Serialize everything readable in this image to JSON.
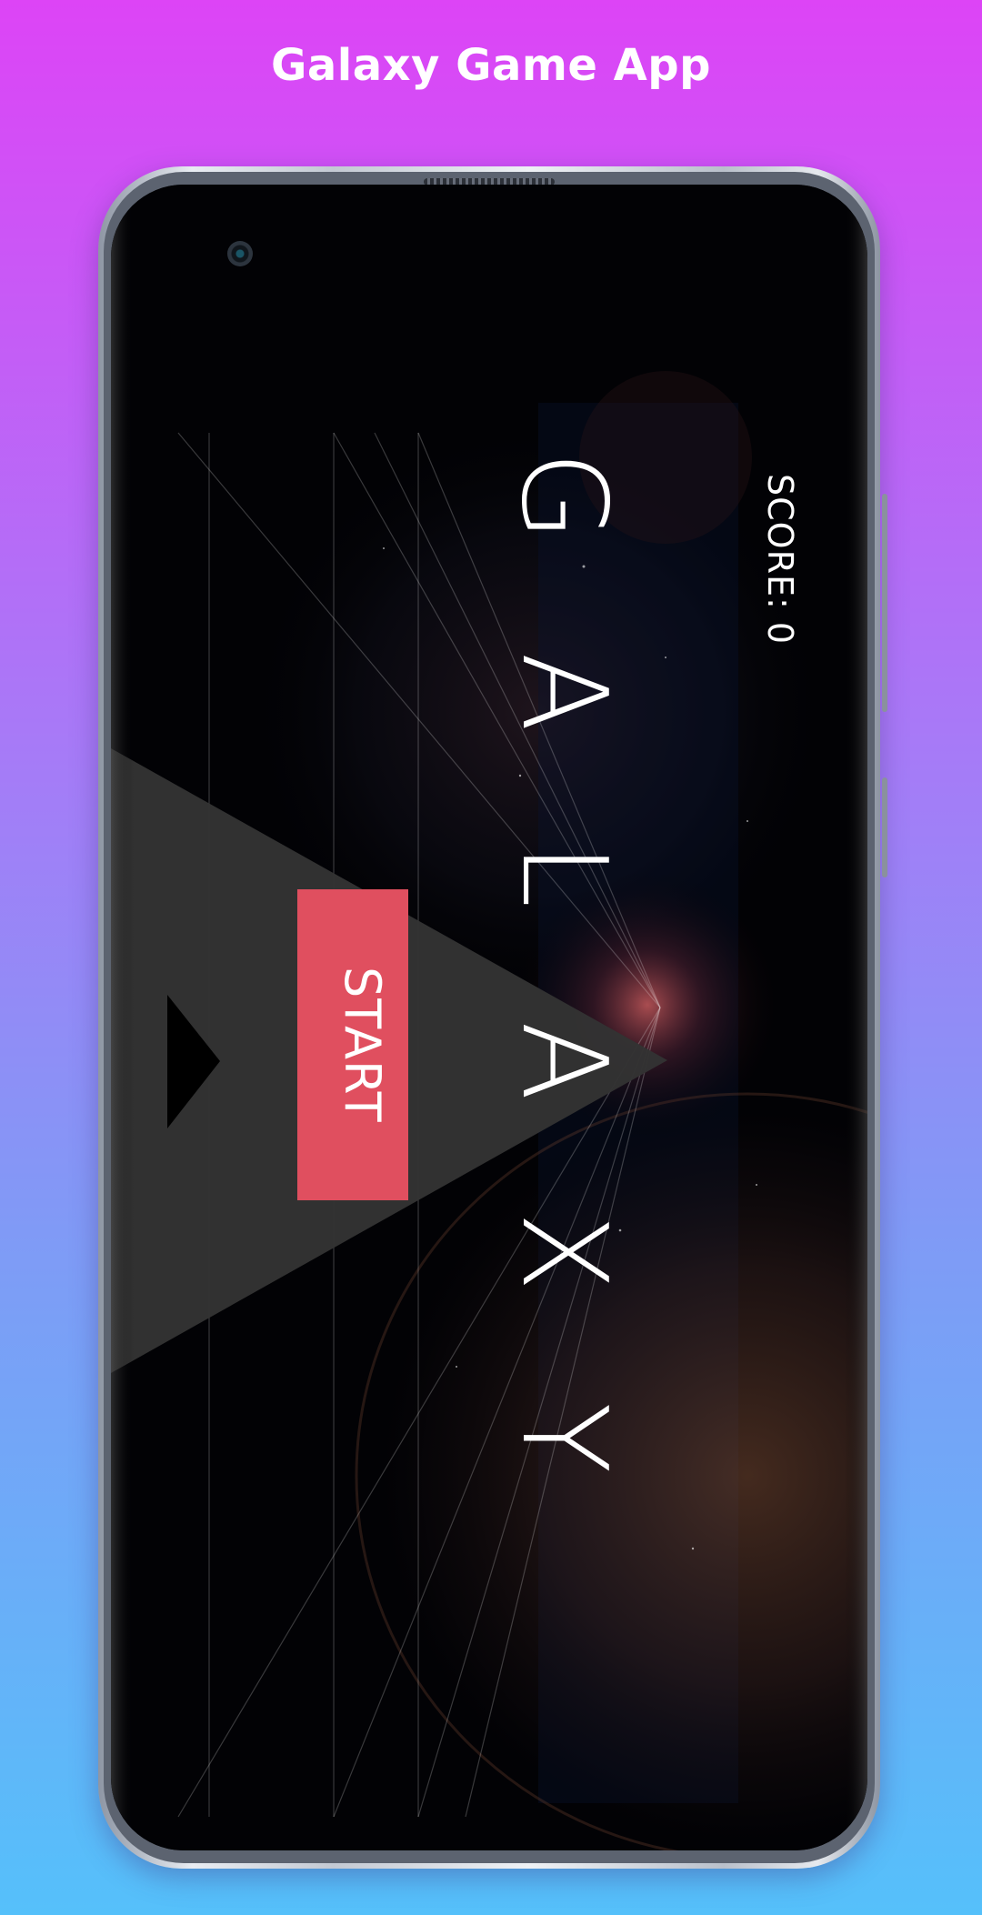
{
  "header": {
    "title": "Galaxy Game App"
  },
  "game": {
    "score_label": "SCORE: 0",
    "title": "GALAXY",
    "start_label": "START"
  },
  "colors": {
    "background_top": "#dd44f6",
    "background_bottom": "#55c0fa",
    "start_button": "#e04f5f",
    "menu_overlay": "#333333",
    "text": "#ffffff"
  },
  "icons": {
    "ship": "triangle-ship-icon",
    "camera": "front-camera-icon"
  }
}
